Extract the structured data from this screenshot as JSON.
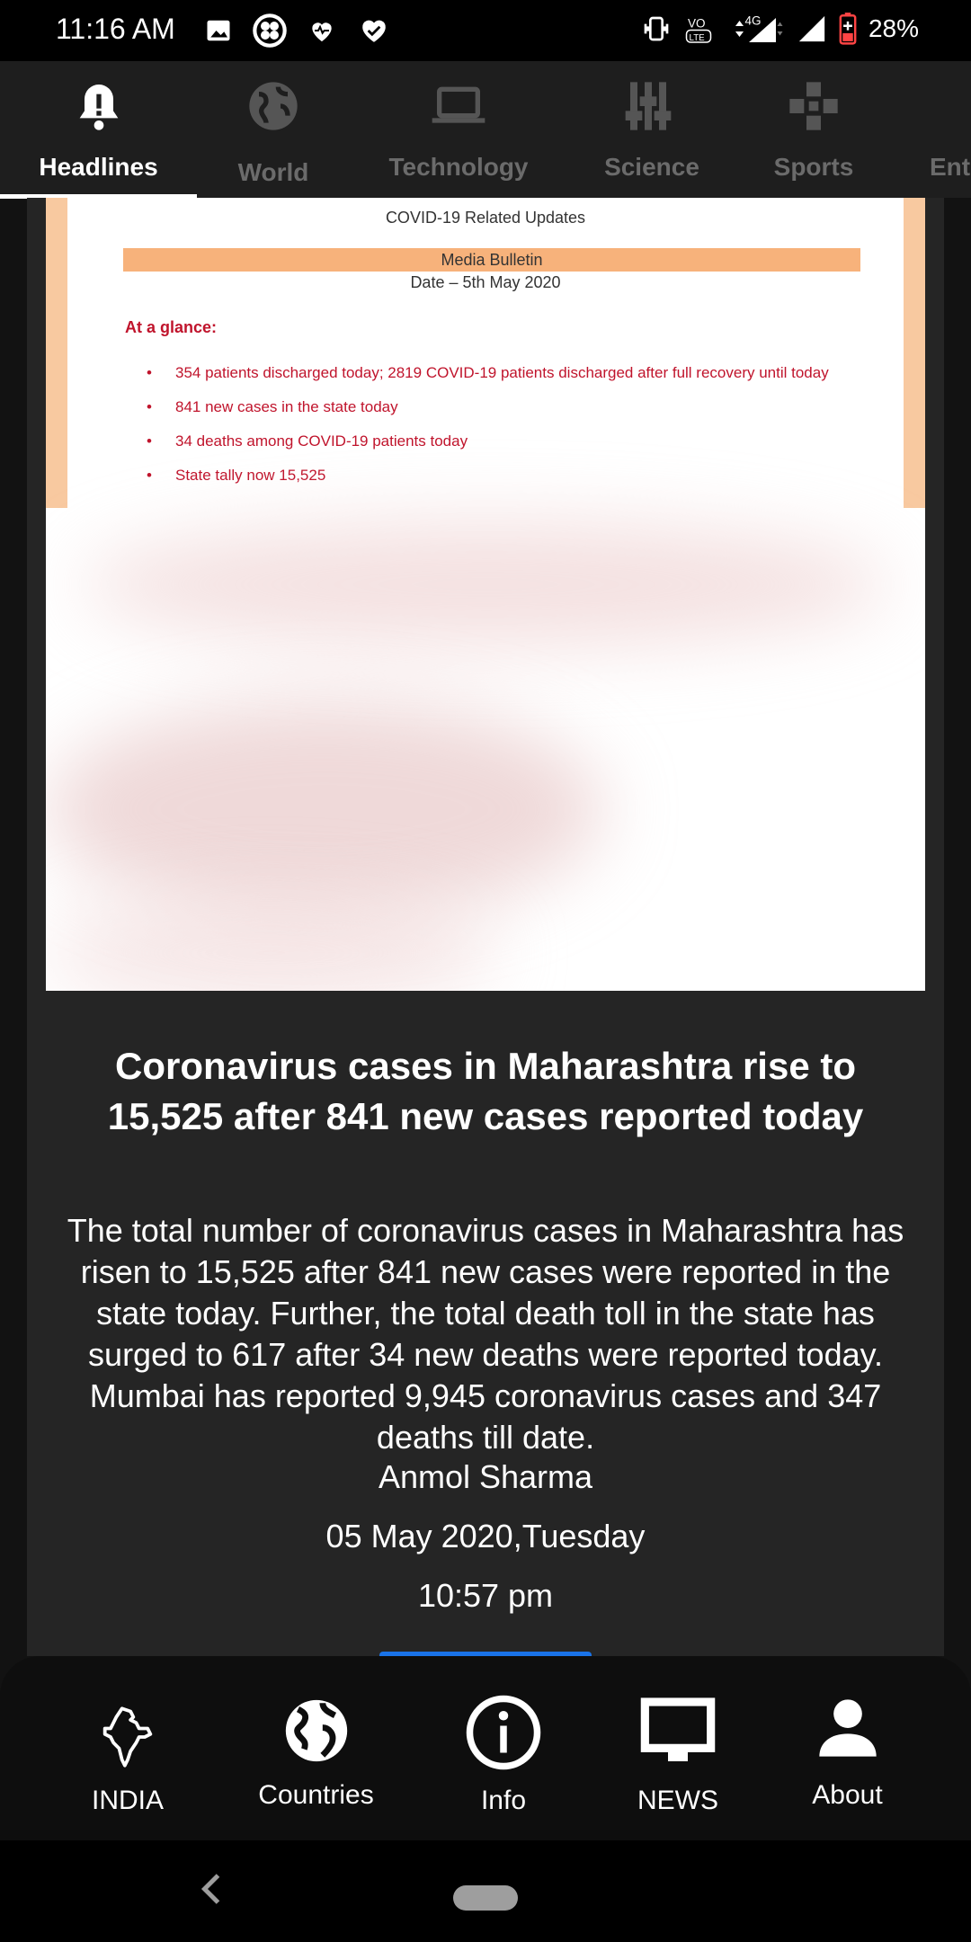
{
  "status_bar": {
    "time": "11:16 AM",
    "network": "4G",
    "volte": "VO LTE",
    "battery": "28%"
  },
  "tabs": [
    {
      "label": "Headlines",
      "icon": "bell-icon",
      "active": true
    },
    {
      "label": "World",
      "icon": "globe-icon",
      "active": false
    },
    {
      "label": "Technology",
      "icon": "laptop-icon",
      "active": false
    },
    {
      "label": "Science",
      "icon": "sliders-icon",
      "active": false
    },
    {
      "label": "Sports",
      "icon": "gamepad-icon",
      "active": false
    },
    {
      "label": "Ent",
      "icon": "",
      "active": false
    }
  ],
  "article": {
    "image": {
      "header": "COVID-19 Related Updates",
      "media_bulletin": "Media Bulletin",
      "date": "Date – 5th May 2020",
      "at_a_glance": "At a glance:",
      "bullets": [
        "354 patients discharged today; 2819 COVID-19 patients discharged after full recovery until today",
        "841 new cases in the state today",
        "34 deaths among COVID-19 patients today",
        "State tally now 15,525"
      ]
    },
    "headline": "Coronavirus cases in Maharashtra rise to 15,525 after 841 new cases reported today",
    "summary": "The total number of coronavirus cases in Maharashtra has risen to 15,525 after 841 new cases were reported in the state today. Further, the total death toll in the state has surged to 617 after 34 new deaths were reported today. Mumbai has reported 9,945 coronavirus cases and 347 deaths till date.",
    "author": "Anmol Sharma",
    "date": "05 May 2020,Tuesday",
    "time": "10:57 pm"
  },
  "bottom_nav": [
    {
      "label": "INDIA",
      "icon": "india-map-icon"
    },
    {
      "label": "Countries",
      "icon": "globe-icon"
    },
    {
      "label": "Info",
      "icon": "info-icon"
    },
    {
      "label": "NEWS",
      "icon": "monitor-icon"
    },
    {
      "label": "About",
      "icon": "person-icon"
    }
  ],
  "colors": {
    "accent_blue": "#1a73e8",
    "bulletin_red": "#c0142c",
    "bulletin_orange": "#f7b27b"
  }
}
